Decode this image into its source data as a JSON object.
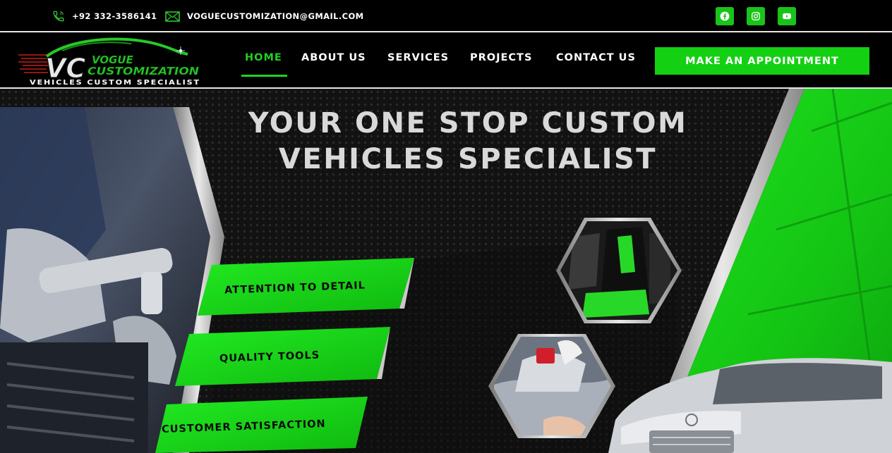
{
  "topbar": {
    "phone": "+92 332-3586141",
    "email": "VOGUECUSTOMIZATION@GMAIL.COM",
    "social": [
      {
        "name": "facebook-icon"
      },
      {
        "name": "instagram-icon"
      },
      {
        "name": "youtube-icon"
      }
    ]
  },
  "logo": {
    "letters": "VC",
    "line1": "VOGUE",
    "line2": "CUSTOMIZATION",
    "tagline": "VEHICLES CUSTOM SPECIALIST"
  },
  "nav": {
    "items": [
      "HOME",
      "ABOUT US",
      "SERVICES",
      "PROJECTS",
      "CONTACT US"
    ],
    "active": "HOME",
    "cta": "MAKE AN APPOINTMENT"
  },
  "hero": {
    "headline_line1": "YOUR ONE STOP CUSTOM",
    "headline_line2": "VEHICLES SPECIALIST",
    "features": [
      "ATTENTION TO DETAIL",
      "QUALITY TOOLS",
      "CUSTOMER SATISFACTION"
    ]
  },
  "colors": {
    "accent": "#1fd11f",
    "background": "#000000",
    "headline": "#d9d9d9"
  }
}
